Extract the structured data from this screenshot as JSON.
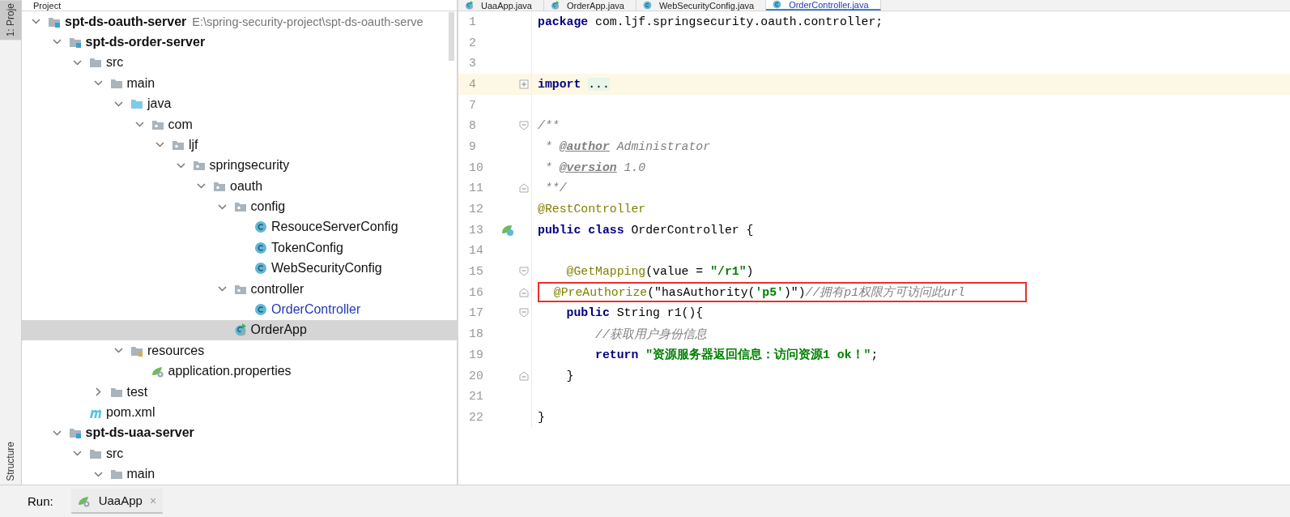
{
  "left_strip": {
    "tabs": [
      {
        "label": "1: Proje",
        "selected": true
      },
      {
        "label": "Structure",
        "selected": false
      }
    ]
  },
  "project_panel": {
    "title": "Project",
    "tree": [
      {
        "label": "spt-ds-oauth-server",
        "kind": "module",
        "path": "E:\\spring-security-project\\spt-ds-oauth-serve",
        "expanded": true,
        "selected": false,
        "modified": false,
        "children": [
          {
            "label": "spt-ds-order-server",
            "kind": "module",
            "expanded": true,
            "selected": false,
            "modified": false,
            "children": [
              {
                "label": "src",
                "kind": "folder",
                "expanded": true,
                "selected": false,
                "modified": false,
                "children": [
                  {
                    "label": "main",
                    "kind": "folder",
                    "expanded": true,
                    "selected": false,
                    "modified": false,
                    "children": [
                      {
                        "label": "java",
                        "kind": "source-folder",
                        "expanded": true,
                        "selected": false,
                        "modified": false,
                        "children": [
                          {
                            "label": "com",
                            "kind": "package",
                            "expanded": true,
                            "selected": false,
                            "modified": false,
                            "children": [
                              {
                                "label": "ljf",
                                "kind": "package",
                                "expanded": true,
                                "selected": false,
                                "modified": false,
                                "children": [
                                  {
                                    "label": "springsecurity",
                                    "kind": "package",
                                    "expanded": true,
                                    "selected": false,
                                    "modified": false,
                                    "children": [
                                      {
                                        "label": "oauth",
                                        "kind": "package",
                                        "expanded": true,
                                        "selected": false,
                                        "modified": false,
                                        "children": [
                                          {
                                            "label": "config",
                                            "kind": "package",
                                            "expanded": true,
                                            "selected": false,
                                            "modified": false,
                                            "children": [
                                              {
                                                "label": "ResouceServerConfig",
                                                "kind": "class",
                                                "selected": false,
                                                "modified": false
                                              },
                                              {
                                                "label": "TokenConfig",
                                                "kind": "class",
                                                "selected": false,
                                                "modified": false
                                              },
                                              {
                                                "label": "WebSecurityConfig",
                                                "kind": "class",
                                                "selected": false,
                                                "modified": false
                                              }
                                            ]
                                          },
                                          {
                                            "label": "controller",
                                            "kind": "package",
                                            "expanded": true,
                                            "selected": false,
                                            "modified": false,
                                            "children": [
                                              {
                                                "label": "OrderController",
                                                "kind": "class",
                                                "selected": false,
                                                "modified": true
                                              }
                                            ]
                                          },
                                          {
                                            "label": "OrderApp",
                                            "kind": "app",
                                            "selected": true,
                                            "modified": false
                                          }
                                        ]
                                      }
                                    ]
                                  }
                                ]
                              }
                            ]
                          }
                        ]
                      },
                      {
                        "label": "resources",
                        "kind": "resources",
                        "expanded": true,
                        "selected": false,
                        "modified": false,
                        "children": [
                          {
                            "label": "application.properties",
                            "kind": "properties",
                            "selected": false,
                            "modified": false
                          }
                        ]
                      }
                    ]
                  },
                  {
                    "label": "test",
                    "kind": "folder",
                    "expanded": false,
                    "selected": false,
                    "modified": false
                  }
                ]
              },
              {
                "label": "pom.xml",
                "kind": "maven",
                "selected": false,
                "modified": false
              }
            ]
          },
          {
            "label": "spt-ds-uaa-server",
            "kind": "module",
            "expanded": true,
            "selected": false,
            "modified": false,
            "children": [
              {
                "label": "src",
                "kind": "folder",
                "expanded": true,
                "selected": false,
                "modified": false,
                "children": [
                  {
                    "label": "main",
                    "kind": "folder",
                    "expanded": true,
                    "selected": false,
                    "modified": false
                  }
                ]
              }
            ]
          }
        ]
      }
    ]
  },
  "editor": {
    "tabs": [
      {
        "label": "UaaApp.java",
        "kind": "app",
        "selected": false
      },
      {
        "label": "OrderApp.java",
        "kind": "app",
        "selected": false
      },
      {
        "label": "WebSecurityConfig.java",
        "kind": "class",
        "selected": false
      },
      {
        "label": "OrderController.java",
        "kind": "class",
        "selected": true
      }
    ],
    "lines": [
      {
        "number": "1",
        "current": false,
        "boxed": false,
        "tokens": [
          {
            "kind": "keyword",
            "text": "package"
          },
          {
            "kind": "plain",
            "text": " com.ljf.springsecurity.oauth.controller;"
          }
        ]
      },
      {
        "number": "2",
        "current": false,
        "boxed": false
      },
      {
        "number": "3",
        "current": false,
        "boxed": false
      },
      {
        "number": "4",
        "current": true,
        "boxed": false,
        "fold": {
          "kind": "collapsed"
        },
        "tokens": [
          {
            "kind": "keyword",
            "text": "import "
          },
          {
            "kind": "folded",
            "text": "..."
          }
        ]
      },
      {
        "number": "7",
        "current": false,
        "boxed": false
      },
      {
        "number": "8",
        "current": false,
        "boxed": false,
        "fold": {
          "kind": "start"
        },
        "tokens": [
          {
            "kind": "comment",
            "text": "/**"
          }
        ]
      },
      {
        "number": "9",
        "current": false,
        "boxed": false,
        "tokens": [
          {
            "kind": "comment",
            "text": " * "
          },
          {
            "kind": "doc-tag",
            "text": "@author"
          },
          {
            "kind": "comment",
            "text": " Administrator"
          }
        ]
      },
      {
        "number": "10",
        "current": false,
        "boxed": false,
        "tokens": [
          {
            "kind": "comment",
            "text": " * "
          },
          {
            "kind": "doc-tag",
            "text": "@version"
          },
          {
            "kind": "comment",
            "text": " 1.0"
          }
        ]
      },
      {
        "number": "11",
        "current": false,
        "boxed": false,
        "fold": {
          "kind": "end"
        },
        "tokens": [
          {
            "kind": "comment",
            "text": " **/"
          }
        ]
      },
      {
        "number": "12",
        "current": false,
        "boxed": false,
        "tokens": [
          {
            "kind": "annotation",
            "text": "@RestController"
          }
        ]
      },
      {
        "number": "13",
        "current": false,
        "boxed": false,
        "marker": {
          "kind": "bean"
        },
        "tokens": [
          {
            "kind": "keyword",
            "text": "public class"
          },
          {
            "kind": "plain",
            "text": " OrderController {"
          }
        ]
      },
      {
        "number": "14",
        "current": false,
        "boxed": false
      },
      {
        "number": "15",
        "current": false,
        "boxed": false,
        "fold": {
          "kind": "start"
        },
        "tokens": [
          {
            "kind": "annotation",
            "text": "    @GetMapping"
          },
          {
            "kind": "plain",
            "text": "(value = "
          },
          {
            "kind": "string",
            "text": "\"/r1\""
          },
          {
            "kind": "plain",
            "text": ")"
          }
        ]
      },
      {
        "number": "16",
        "current": false,
        "boxed": true,
        "fold": {
          "kind": "end"
        },
        "tokens": [
          {
            "kind": "annotation",
            "text": "  @PreAuthorize"
          },
          {
            "kind": "plain",
            "text": "(\"hasAuthority("
          },
          {
            "kind": "string",
            "text": "'p5'"
          },
          {
            "kind": "plain",
            "text": ")\")"
          },
          {
            "kind": "comment",
            "text": "//拥有p1权限方可访问此url"
          }
        ]
      },
      {
        "number": "17",
        "current": false,
        "boxed": false,
        "fold": {
          "kind": "start"
        },
        "tokens": [
          {
            "kind": "keyword",
            "text": "    public"
          },
          {
            "kind": "plain",
            "text": " String r1(){"
          }
        ]
      },
      {
        "number": "18",
        "current": false,
        "boxed": false,
        "tokens": [
          {
            "kind": "comment",
            "text": "        //获取用户身份信息"
          }
        ]
      },
      {
        "number": "19",
        "current": false,
        "boxed": false,
        "tokens": [
          {
            "kind": "keyword",
            "text": "        return "
          },
          {
            "kind": "string",
            "text": "\"资源服务器返回信息：访问资源1 ok！\""
          },
          {
            "kind": "plain",
            "text": ";"
          }
        ]
      },
      {
        "number": "20",
        "current": false,
        "boxed": false,
        "fold": {
          "kind": "end"
        },
        "tokens": [
          {
            "kind": "plain",
            "text": "    }"
          }
        ]
      },
      {
        "number": "21",
        "current": false,
        "boxed": false
      },
      {
        "number": "22",
        "current": false,
        "boxed": false,
        "tokens": [
          {
            "kind": "plain",
            "text": "}"
          }
        ]
      }
    ]
  },
  "run_bar": {
    "label": "Run:",
    "tabs": [
      {
        "label": "UaaApp",
        "close": "×",
        "selected": true
      }
    ]
  }
}
